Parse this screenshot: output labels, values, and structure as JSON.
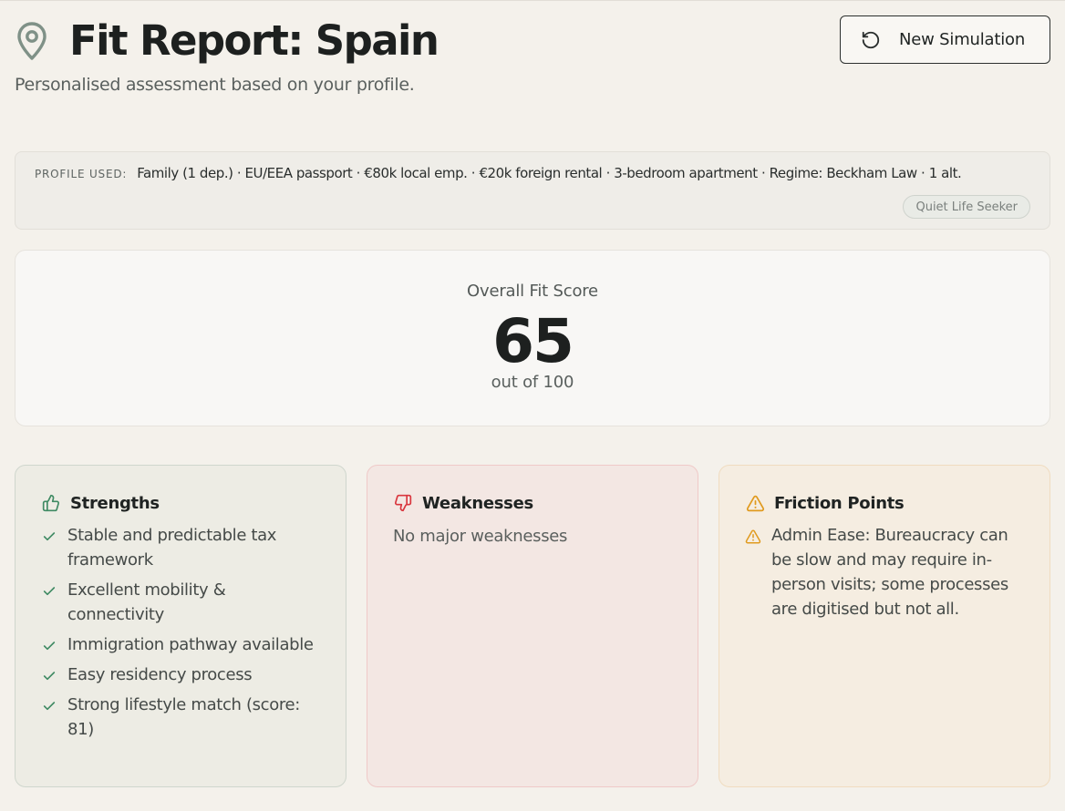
{
  "header": {
    "title": "Fit Report: Spain",
    "subtitle": "Personalised assessment based on your profile.",
    "new_simulation_label": "New Simulation",
    "pin_icon": "map-pin-icon",
    "refresh_icon": "rotate-ccw-icon"
  },
  "profile": {
    "label": "PROFILE USED:",
    "summary": "Family (1 dep.) · EU/EEA passport · €80k local emp. · €20k foreign rental · 3-bedroom apartment · Regime: Beckham Law · 1 alt.",
    "persona": "Quiet Life Seeker"
  },
  "score": {
    "label": "Overall Fit Score",
    "value": 65,
    "max_label": "out of 100"
  },
  "strengths": {
    "title": "Strengths",
    "icon": "thumbs-up-icon",
    "items": [
      "Stable and predictable tax framework",
      "Excellent mobility & connectivity",
      "Immigration pathway available",
      "Easy residency process",
      "Strong lifestyle match (score: 81)"
    ]
  },
  "weaknesses": {
    "title": "Weaknesses",
    "icon": "thumbs-down-icon",
    "empty": "No major weaknesses"
  },
  "friction": {
    "title": "Friction Points",
    "icon": "alert-triangle-icon",
    "items": [
      "Admin Ease: Bureaucracy can be slow and may require in-person visits; some processes are digitised but not all."
    ]
  },
  "colors": {
    "background": "#f4f1eb",
    "strength_accent": "#3f8a63",
    "weakness_accent": "#d9363e",
    "friction_accent": "#e09a1e"
  }
}
